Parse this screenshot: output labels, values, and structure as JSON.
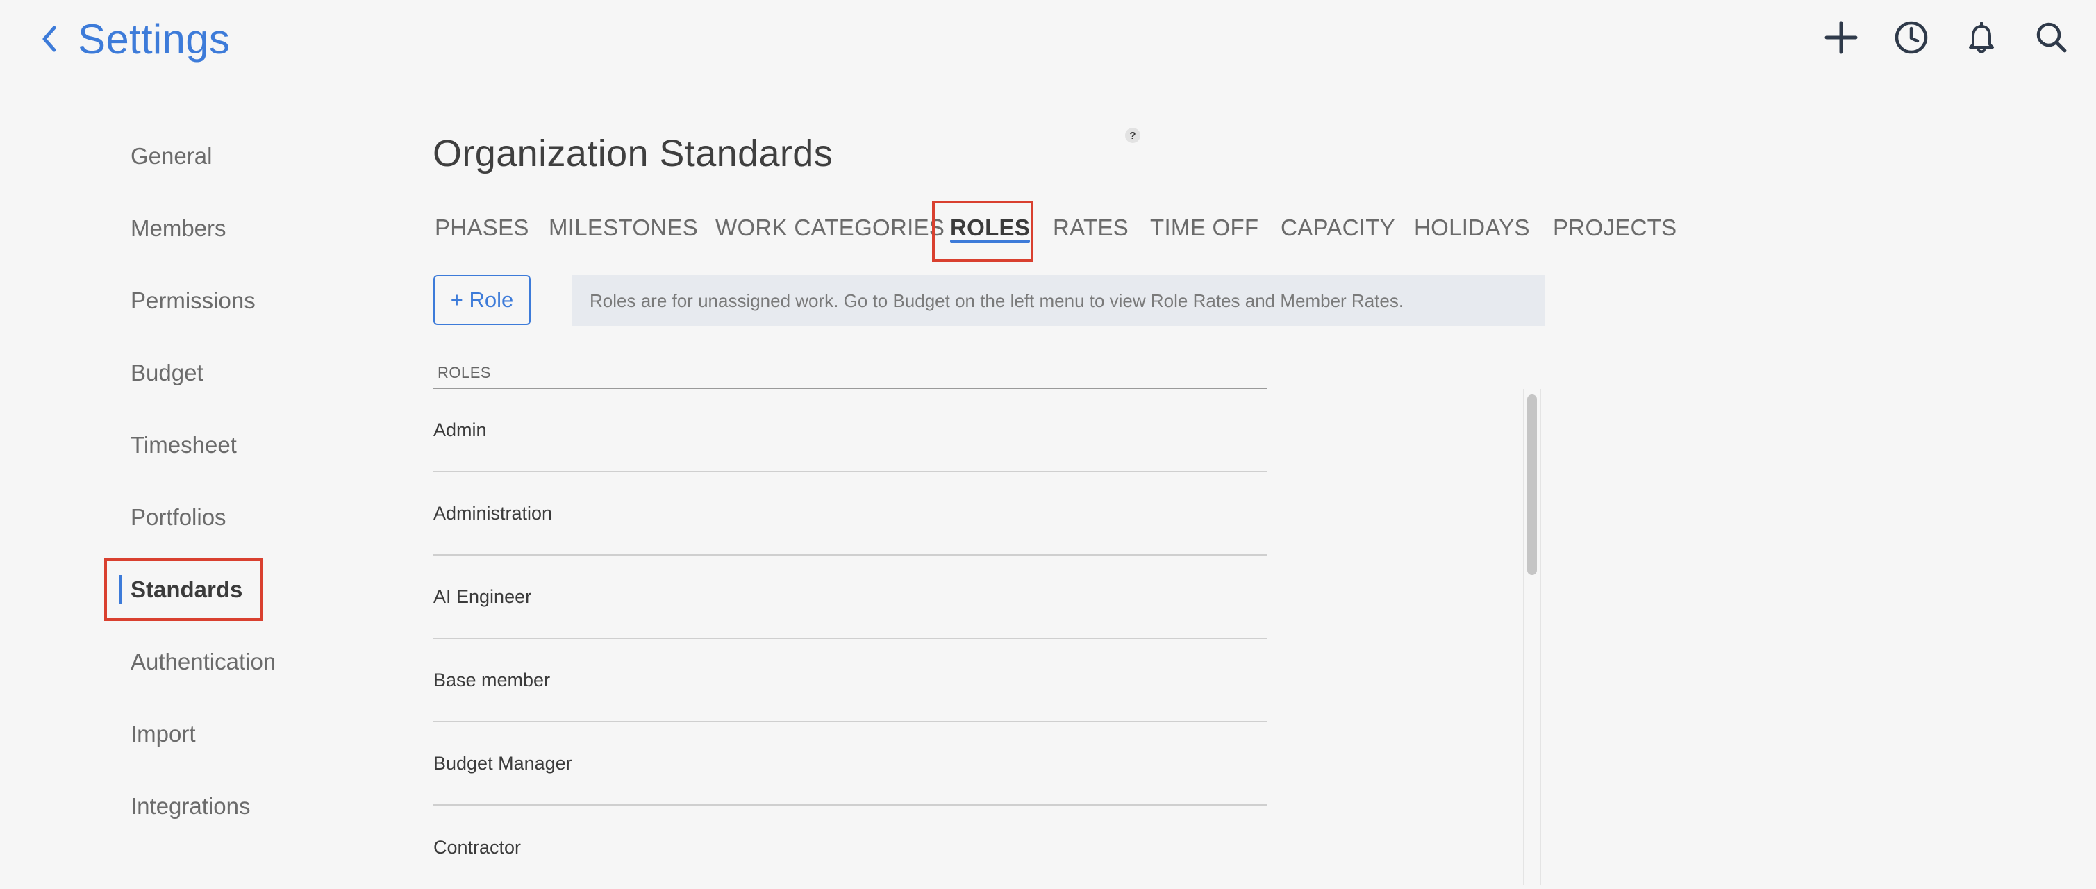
{
  "header": {
    "title": "Settings",
    "icons": [
      "back-chevron-icon",
      "plus-icon",
      "clock-icon",
      "bell-icon",
      "search-icon"
    ]
  },
  "sidebar": {
    "items": [
      {
        "label": "General"
      },
      {
        "label": "Members"
      },
      {
        "label": "Permissions"
      },
      {
        "label": "Budget"
      },
      {
        "label": "Timesheet"
      },
      {
        "label": "Portfolios"
      },
      {
        "label": "Standards",
        "active": true
      },
      {
        "label": "Authentication"
      },
      {
        "label": "Import"
      },
      {
        "label": "Integrations"
      }
    ]
  },
  "main": {
    "title": "Organization Standards",
    "help_label": "?",
    "tabs": [
      {
        "label": "PHASES"
      },
      {
        "label": "MILESTONES"
      },
      {
        "label": "WORK CATEGORIES"
      },
      {
        "label": "ROLES",
        "active": true
      },
      {
        "label": "RATES"
      },
      {
        "label": "TIME OFF"
      },
      {
        "label": "CAPACITY"
      },
      {
        "label": "HOLIDAYS"
      },
      {
        "label": "PROJECTS"
      }
    ],
    "add_role_label": "+ Role",
    "notice": "Roles are for unassigned work. Go to Budget on the left menu to view Role Rates and Member Rates.",
    "roles_header": "ROLES",
    "roles": [
      "Admin",
      "Administration",
      "AI Engineer",
      "Base member",
      "Budget Manager",
      "Contractor"
    ]
  },
  "colors": {
    "accent": "#3d7bd9",
    "highlight_outline": "#d9402f",
    "background": "#f6f6f6"
  }
}
